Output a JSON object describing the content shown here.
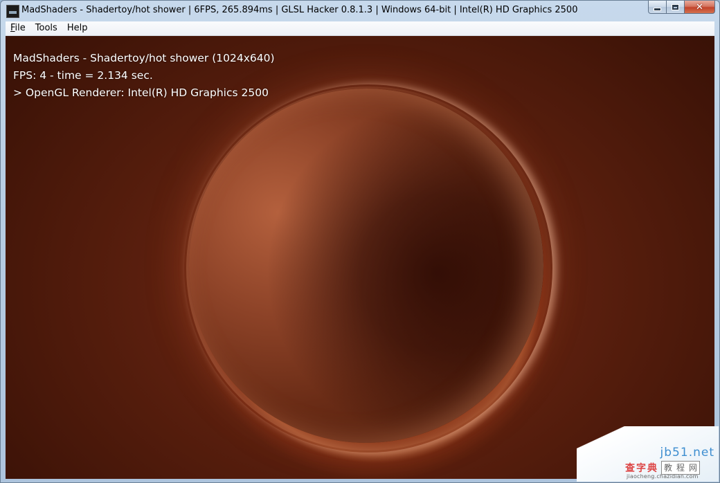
{
  "window": {
    "title": "MadShaders - Shadertoy/hot shower | 6FPS, 265.894ms | GLSL Hacker 0.8.1.3 | Windows 64-bit | Intel(R) HD Graphics 2500",
    "controls": {
      "minimize": "minimize",
      "maximize": "maximize",
      "close": "✕"
    }
  },
  "menu": {
    "file_mn": "F",
    "file_rest": "ile",
    "tools": "Tools",
    "help": "Help"
  },
  "overlay": {
    "line1": "MadShaders - Shadertoy/hot shower (1024x640)",
    "line2": "FPS: 4 - time = 2.134 sec.",
    "line3": "> OpenGL Renderer: Intel(R) HD Graphics 2500"
  },
  "watermark": {
    "site": "jb51.net",
    "c1": "查",
    "c2": "字",
    "c3": "典",
    "b1": "教",
    "b2": "程",
    "b3": "网",
    "url": "jiaocheng.chazidian.com"
  },
  "colors": {
    "titlebar": "#b7cde3",
    "render_bg": "#5a1f0e",
    "overlay_text": "#ffffff",
    "watermark_site": "#3e8ed0"
  }
}
